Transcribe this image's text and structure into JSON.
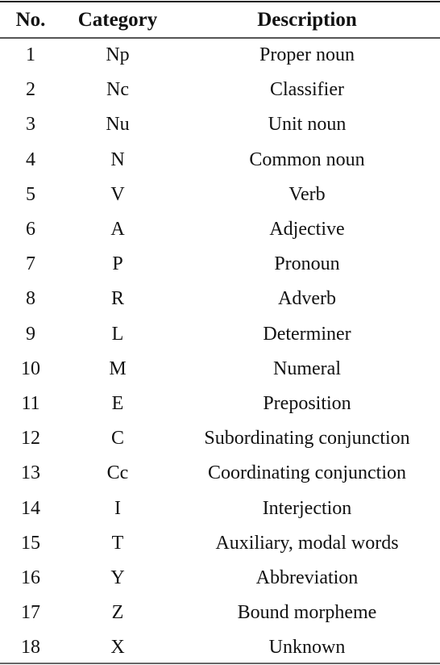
{
  "table": {
    "headers": [
      "No.",
      "Category",
      "Description"
    ],
    "rows": [
      [
        "1",
        "Np",
        "Proper noun"
      ],
      [
        "2",
        "Nc",
        "Classifier"
      ],
      [
        "3",
        "Nu",
        "Unit noun"
      ],
      [
        "4",
        "N",
        "Common noun"
      ],
      [
        "5",
        "V",
        "Verb"
      ],
      [
        "6",
        "A",
        "Adjective"
      ],
      [
        "7",
        "P",
        "Pronoun"
      ],
      [
        "8",
        "R",
        "Adverb"
      ],
      [
        "9",
        "L",
        "Determiner"
      ],
      [
        "10",
        "M",
        "Numeral"
      ],
      [
        "11",
        "E",
        "Preposition"
      ],
      [
        "12",
        "C",
        "Subordinating conjunction"
      ],
      [
        "13",
        "Cc",
        "Coordinating conjunction"
      ],
      [
        "14",
        "I",
        "Interjection"
      ],
      [
        "15",
        "T",
        "Auxiliary, modal words"
      ],
      [
        "16",
        "Y",
        "Abbreviation"
      ],
      [
        "17",
        "Z",
        "Bound morpheme"
      ],
      [
        "18",
        "X",
        "Unknown"
      ]
    ]
  }
}
